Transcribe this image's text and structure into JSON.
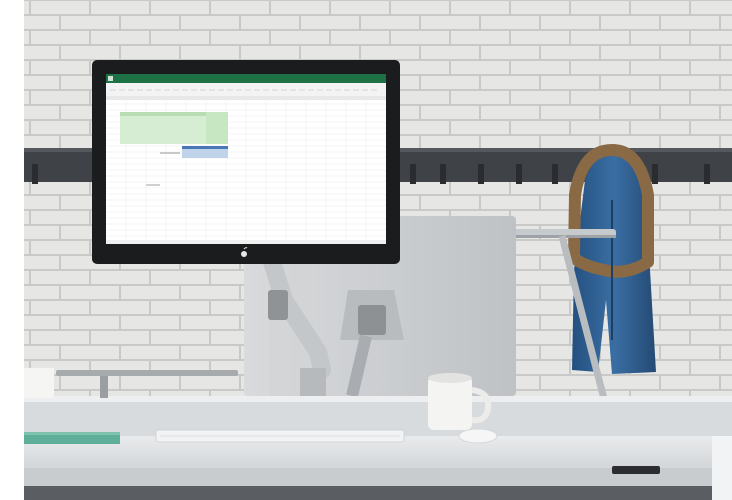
{
  "scene": {
    "subject": "office-desk-with-monitor",
    "colors": {
      "wall": "#e6e6e4",
      "mortar": "#c9c9c7",
      "rail": "#3f4246",
      "desk_top": "#dfe2e4",
      "desk_front": "#c9ccce",
      "monitor_bezel": "#1b1c1e",
      "excel_green": "#1e7145",
      "sheet_highlight": "#d6ecd3",
      "jacket": "#2f5d8e",
      "fur": "#8a6a45",
      "lamp": "#b9bdc0",
      "mug": "#f4f4f2",
      "book": "#5fae9a"
    },
    "icons": [
      "apple-logo-icon",
      "excel-app-icon"
    ]
  }
}
